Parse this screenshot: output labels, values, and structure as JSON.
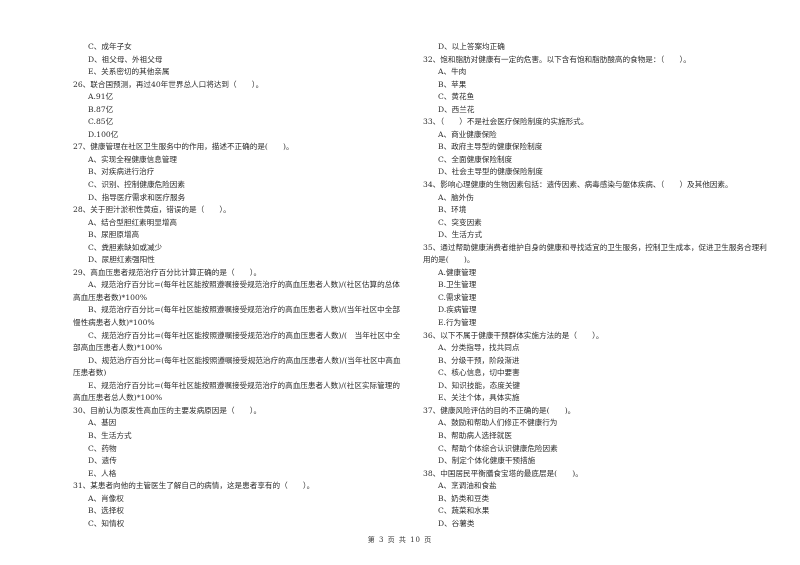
{
  "page": {
    "footer": "第 3 页 共 10 页"
  },
  "left_column": {
    "continued_options": [
      "C、成年子女",
      "D、祖父母、外祖父母",
      "E、关系密切的其他亲属"
    ],
    "questions": [
      {
        "number": "26",
        "stem": "26、联合国预测，再过40年世界总人口将达到（　　）。",
        "options": [
          "A.91亿",
          "B.87亿",
          "C.85亿",
          "D.100亿"
        ]
      },
      {
        "number": "27",
        "stem": "27、健康管理在社区卫生服务中的作用，描述不正确的是(　　)。",
        "options": [
          "A、实现全程健康信息管理",
          "B、对疾病进行治疗",
          "C、识别、控制健康危险因素",
          "D、指导医疗需求和医疗服务"
        ]
      },
      {
        "number": "28",
        "stem": "28、关于胆汁淤积性黄疸，错误的是（　　）。",
        "options": [
          "A、结合型胆红素明显增高",
          "B、尿胆原增高",
          "C、粪胆素缺如或减少",
          "D、尿胆红素强阳性"
        ]
      },
      {
        "number": "29",
        "stem": "29、高血压患者规范治疗百分比计算正确的是（　　）。",
        "options": [
          "A、规范治疗百分比=(每年社区能按照遵嘱接受规范治疗的高血压患者人数)/(社区估算的总体高血压患者数)*100%",
          "B、规范治疗百分比=(每年社区能按照遵嘱接受规范治疗的高血压患者人数)/(当年社区中全部慢性病患者人数)*100%",
          "C、规范治疗百分比=(每年社区能按照遵嘱接受规范治疗的高血压患者人数)/(　当年社区中全部高血压患者人数)*100%",
          "D、规范治疗百分比=(每年社区能按照遵嘱接受规范治疗的高血压患者人数)/(当年社区中高血压患者数)",
          "E、规范治疗百分比=(每年社区能按照遵嘱接受规范治疗的高血压患者人数)/(社区实际管理的高血压患者总人数)*100%"
        ]
      },
      {
        "number": "30",
        "stem": "30、目前认为原发性高血压的主要发病原因是（　　）。",
        "options": [
          "A、基因",
          "B、生活方式",
          "C、药物",
          "D、遗传",
          "E、人格"
        ]
      },
      {
        "number": "31",
        "stem": "31、某患者向他的主管医生了解自己的病情，这是患者享有的（　　）。",
        "options": [
          "A、肖像权",
          "B、选择权",
          "C、知情权"
        ]
      }
    ]
  },
  "right_column": {
    "continued_options": [
      "D、以上答案均正确"
    ],
    "questions": [
      {
        "number": "32",
        "stem": "32、饱和脂肪对健康有一定的危害。以下含有饱和脂肪酸高的食物是：（　　）。",
        "options": [
          "A、牛肉",
          "B、苹果",
          "C、黄花鱼",
          "D、西兰花"
        ]
      },
      {
        "number": "33",
        "stem": "33、（　　）不是社会医疗保险制度的实施形式。",
        "options": [
          "A、商业健康保险",
          "B、政府主导型的健康保险制度",
          "C、全面健康保险制度",
          "D、社会主导型的健康保险制度"
        ]
      },
      {
        "number": "34",
        "stem": "34、影响心理健康的生物因素包括：遗传因素、病毒感染与躯体疾病、（　　）及其他因素。",
        "options": [
          "A、脑外伤",
          "B、环境",
          "C、突变因素",
          "D、生活方式"
        ]
      },
      {
        "number": "35",
        "stem": "35、通过帮助健康消费者维护自身的健康和寻找适宜的卫生服务，控制卫生成本，促进卫生服务合理利用的是(　　)。",
        "options": [
          "A.健康管理",
          "B.卫生管理",
          "C.需求管理",
          "D.疾病管理",
          "E.行为管理"
        ]
      },
      {
        "number": "36",
        "stem": "36、以下不属于健康干预群体实施方法的是（　　）。",
        "options": [
          "A、分类指导，找共同点",
          "B、分级干预，阶段渐进",
          "C、核心信息，切中要害",
          "D、知识技能，态度关键",
          "E、关注个体，具体实施"
        ]
      },
      {
        "number": "37",
        "stem": "37、健康风险评估的目的不正确的是(　　)。",
        "options": [
          "A、鼓励和帮助人们修正不健康行为",
          "B、帮助病人选择就医",
          "C、帮助个体综合认识健康危险因素",
          "D、制定个体化健康干预措施"
        ]
      },
      {
        "number": "38",
        "stem": "38、中国居民平衡膳食宝塔的最底层是(　　)。",
        "options": [
          "A、烹调油和食盐",
          "B、奶类和豆类",
          "C、蔬菜和水果",
          "D、谷薯类"
        ]
      }
    ]
  }
}
